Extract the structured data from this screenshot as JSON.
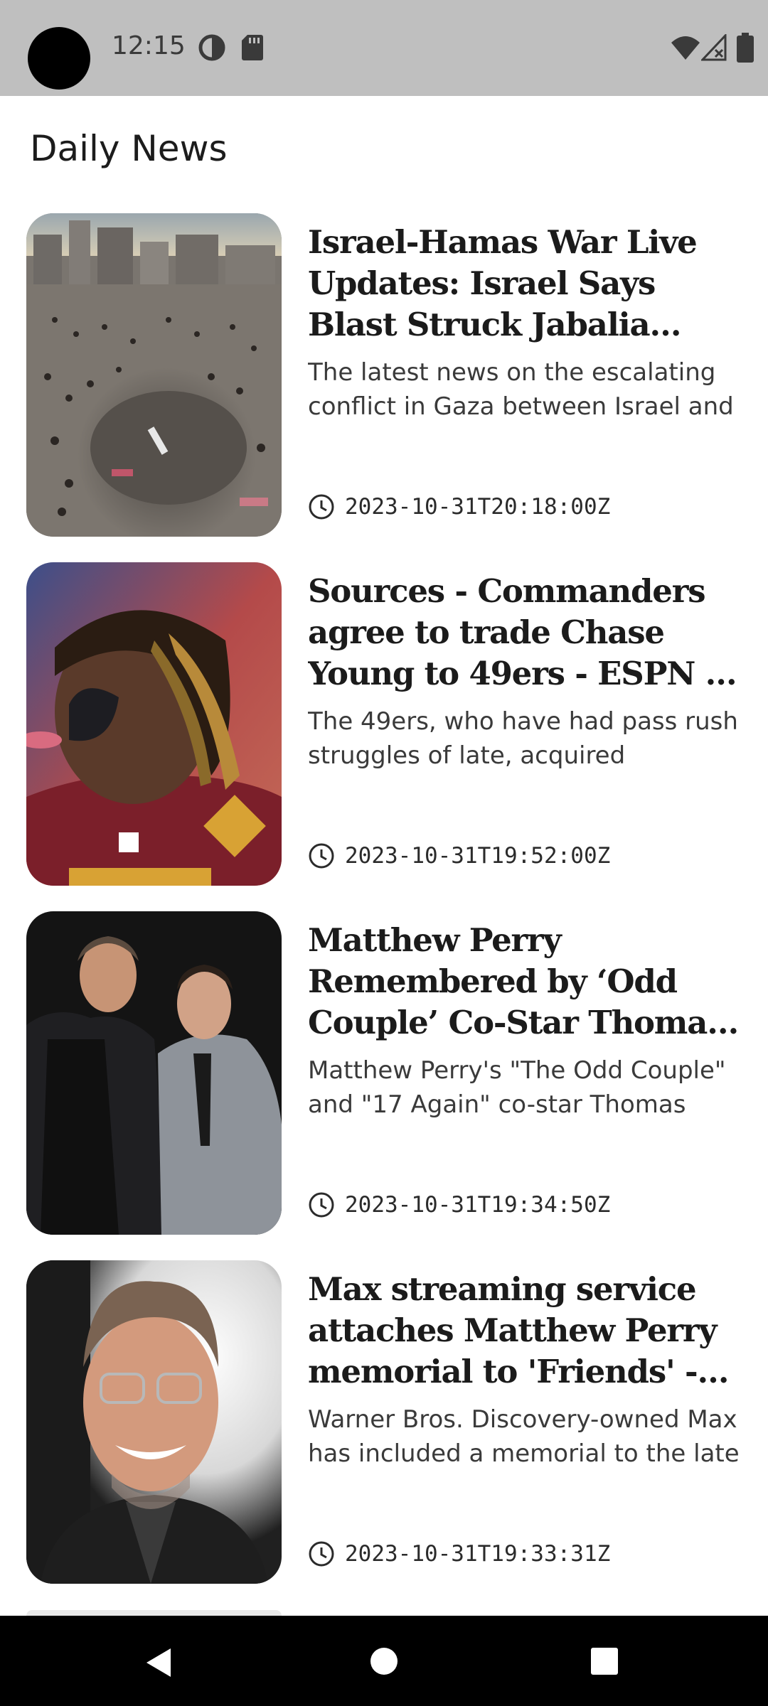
{
  "status_bar": {
    "time": "12:15",
    "icons": [
      "data-saver-icon",
      "sd-card-icon",
      "wifi-icon",
      "signal-icon",
      "battery-icon"
    ]
  },
  "app": {
    "title": "Daily News"
  },
  "articles": [
    {
      "headline": "Israel-Hamas War Live Updates: Israel Says Blast Struck Jabalia Refugee Camp in Gaza",
      "summary": "The latest news on the escalating conflict in Gaza between Israel and",
      "timestamp": "2023-10-31T20:18:00Z",
      "image": "war-rubble-photo"
    },
    {
      "headline": "Sources - Commanders agree to trade Chase Young to 49ers - ESPN - ESPN",
      "summary": "The 49ers, who have had pass rush struggles of late, acquired defensive",
      "timestamp": "2023-10-31T19:52:00Z",
      "image": "football-player-photo"
    },
    {
      "headline": "Matthew Perry Remembered by ‘Odd Couple’ Co-Star Thomas Lennon",
      "summary": "Matthew Perry's \"The Odd Couple\" and \"17 Again\" co-star Thomas",
      "timestamp": "2023-10-31T19:34:50Z",
      "image": "two-men-photo"
    },
    {
      "headline": "Max streaming service attaches Matthew Perry memorial to 'Friends' - Fox News",
      "summary": "Warner Bros. Discovery-owned Max has included a memorial to the late",
      "timestamp": "2023-10-31T19:33:31Z",
      "image": "portrait-photo"
    }
  ],
  "colors": {
    "status_bar_bg": "#bfbfbf",
    "nav_bar_bg": "#000000",
    "background": "#ffffff"
  }
}
